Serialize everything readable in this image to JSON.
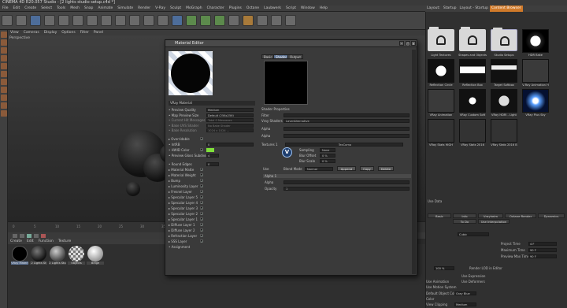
{
  "window": {
    "title": "CINEMA 4D R20.057 Studio - [2 lights studio setup.c4d *]"
  },
  "menubar": [
    "File",
    "Edit",
    "Create",
    "Select",
    "Tools",
    "Mesh",
    "Snap",
    "Animate",
    "Simulate",
    "Render",
    "V-Ray",
    "Sculpt",
    "MoGraph",
    "Character",
    "Plugins",
    "Octane",
    "Laubwerk",
    "Script",
    "Window",
    "Help"
  ],
  "layout": {
    "label": "Layout:",
    "items": [
      "Startup",
      "Layout - Startup",
      "V-Ray Render Setup"
    ],
    "selected": "Content Browser"
  },
  "viewport": {
    "menu": [
      "View",
      "Cameras",
      "Display",
      "Options",
      "Filter",
      "Panel"
    ],
    "label": "Perspective"
  },
  "timeline": {
    "ticks": [
      "0",
      "5",
      "10",
      "15",
      "20",
      "25",
      "30",
      "35",
      "40",
      "45",
      "50",
      "55",
      "60",
      "65",
      "70",
      "75",
      "80",
      "85",
      "90"
    ]
  },
  "material_manager": {
    "menu": [
      "Create",
      "Edit",
      "Function",
      "Texture"
    ],
    "materials": [
      {
        "name": "VRay Materi",
        "style": "black"
      },
      {
        "name": "2 Lights St",
        "style": "dark"
      },
      {
        "name": "2 Lights Stu",
        "style": "soft"
      },
      {
        "name": "Objects",
        "style": "checker"
      },
      {
        "name": "Beige",
        "style": "white"
      }
    ]
  },
  "content_browser": {
    "folders": [
      "Light Textures",
      "Shapes and Objects",
      "Studio Setups",
      "HDR Bake"
    ],
    "row2": [
      "Reflection Circle",
      "Reflection Box",
      "Target Softbox",
      "V-Ray Animation H"
    ],
    "row3": [
      "VRay Animation",
      "VRay Custom Soft",
      "VRay HDRI - Light",
      "VRay Plus Sky"
    ],
    "row4": [
      "VRay Stats HIGH",
      "VRay Stats 2016",
      "VRay Stats 2016 B"
    ]
  },
  "attributes": {
    "tabs": [
      "Basic",
      "Info",
      "Vrayheim",
      "Octane Render",
      "Dynamics"
    ],
    "tabs2": [
      "To Do",
      "Use Interpolation"
    ],
    "section": "Use Data",
    "fields": [
      {
        "label": "Projection",
        "value": "Cubic"
      },
      {
        "label": "Project Time",
        "value": "4 F"
      },
      {
        "label": "Maximum Time",
        "value": "90 F"
      },
      {
        "label": "Preview Max Time",
        "value": "90 F"
      },
      {
        "label": "Render LOD in Editor",
        "value": ""
      },
      {
        "label": "Use Expression",
        "value": ""
      },
      {
        "label": "Use Deformers",
        "value": ""
      },
      {
        "label": "Use Animation",
        "value": ""
      },
      {
        "label": "Use Motion System",
        "value": ""
      },
      {
        "label": "Default Object Color",
        "value": "Gray Blue"
      },
      {
        "label": "Color",
        "value": ""
      },
      {
        "label": "View Clipping",
        "value": "Medium"
      }
    ],
    "lod_value": "100 %"
  },
  "dialog": {
    "title": "Material Editor",
    "material_name": "VRay Material",
    "tabs": [
      "Basic",
      "Shader",
      "Output"
    ],
    "active_tab": "Shader",
    "left_props": [
      {
        "label": "Preview Quality",
        "value": "Medium",
        "type": "dropdown"
      },
      {
        "label": "Map Preview Size",
        "value": "Default (256x256)",
        "type": "dropdown"
      },
      {
        "label": "Current Hit Messages",
        "value": "Total 0 Messages",
        "type": "dim"
      },
      {
        "label": "Bake UVS Shader",
        "value": "No Bake Shader",
        "type": "dim"
      },
      {
        "label": "Bake Resolution",
        "value": "1024 x 1024 ...",
        "type": "dim"
      },
      {
        "label": "Overridable",
        "value": "",
        "type": "check"
      },
      {
        "label": "IntRB",
        "value": "0",
        "type": "slider"
      },
      {
        "label": "HWID Color",
        "value": "",
        "type": "color"
      },
      {
        "label": "Preview Gloss Subdivs",
        "value": "4",
        "type": "number"
      },
      {
        "label": "Round Edges",
        "value": "0",
        "type": "number"
      },
      {
        "label": "Material Matte",
        "value": "",
        "type": "check"
      },
      {
        "label": "Material Weight",
        "value": "",
        "type": "check"
      },
      {
        "label": "Bump",
        "value": "",
        "type": "check"
      },
      {
        "label": "Luminosity Layer",
        "value": "",
        "type": "check"
      },
      {
        "label": "Fresnel Layer",
        "value": "",
        "type": "check"
      },
      {
        "label": "Specular Layer 5",
        "value": "",
        "type": "check"
      },
      {
        "label": "Specular Layer 4",
        "value": "",
        "type": "check"
      },
      {
        "label": "Specular Layer 3",
        "value": "",
        "type": "check"
      },
      {
        "label": "Specular Layer 2",
        "value": "",
        "type": "check"
      },
      {
        "label": "Specular Layer 1",
        "value": "",
        "type": "check"
      },
      {
        "label": "Diffuse Layer 1",
        "value": "",
        "type": "check"
      },
      {
        "label": "Diffuse Layer 2",
        "value": "",
        "type": "check"
      },
      {
        "label": "Refraction Layer",
        "value": "",
        "type": "check"
      },
      {
        "label": "SSS Layer",
        "value": "",
        "type": "check"
      },
      {
        "label": "Assignment",
        "value": "",
        "type": "none"
      }
    ],
    "shader_props_header": "Shader Properties",
    "filter_label": "Filter",
    "vray_shader_label": "Vray Shaders",
    "vray_shader_value": "LayerAlternative",
    "alpha_label": "Alpha",
    "alpha2_label": "Alpha",
    "textures_label": "Textures 1",
    "tex_value": "TexComp",
    "sampling_label": "Sampling",
    "sampling_value": "None",
    "blur_offset_label": "Blur Offset",
    "blur_offset_value": "0 %",
    "blur_scale_label": "Blur Scale",
    "blur_scale_value": "0 %",
    "use_label": "Use",
    "blend_label": "Blend Mode",
    "blend_value": "Normal",
    "buttons": [
      "Append",
      "Copy",
      "Delete"
    ],
    "alpha_section": "Alpha 1",
    "alpha_row": "Alpha",
    "opacity_label": "Opacity",
    "opacity_value": "1"
  }
}
